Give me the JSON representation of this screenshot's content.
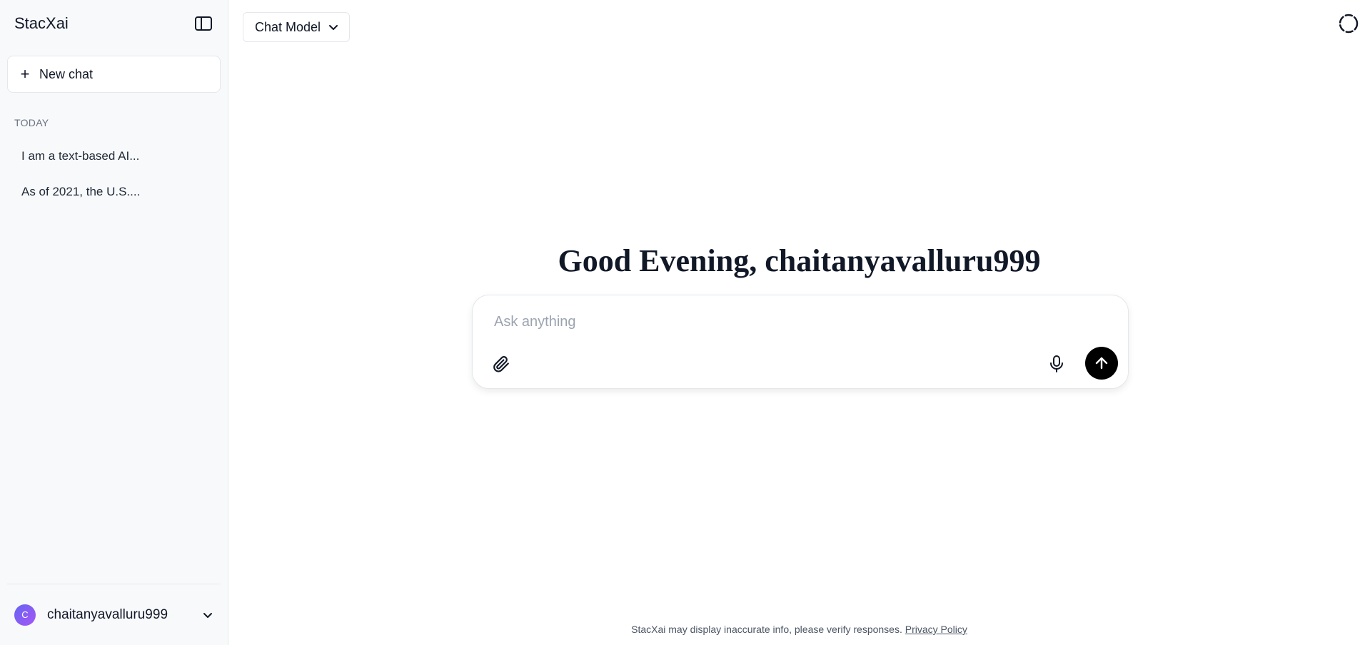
{
  "sidebar": {
    "app_title": "StacXai",
    "new_chat_label": "New chat",
    "section_label": "TODAY",
    "history": [
      {
        "label": "I am a text-based AI..."
      },
      {
        "label": "As of 2021, the U.S...."
      }
    ],
    "user": {
      "avatar_initial": "C",
      "name": "chaitanyavalluru999"
    }
  },
  "header": {
    "model_selector_label": "Chat Model"
  },
  "main": {
    "greeting": "Good Evening, chaitanyavalluru999",
    "input_placeholder": "Ask anything",
    "input_value": "",
    "disclaimer_text": "StacXai may display inaccurate info, please verify responses.",
    "privacy_link": "Privacy Policy"
  },
  "icons": {
    "sidebar_toggle": "sidebar-toggle-icon",
    "plus": "plus-icon",
    "chevron": "chevron-down-icon",
    "loader": "loader-icon",
    "attach": "paperclip-icon",
    "mic": "microphone-icon",
    "send": "arrow-up-icon"
  },
  "colors": {
    "sidebar_bg": "#f8f9fb",
    "send_button_bg": "#000000",
    "avatar_gradient_start": "#6366f1",
    "avatar_gradient_end": "#a855f7"
  }
}
